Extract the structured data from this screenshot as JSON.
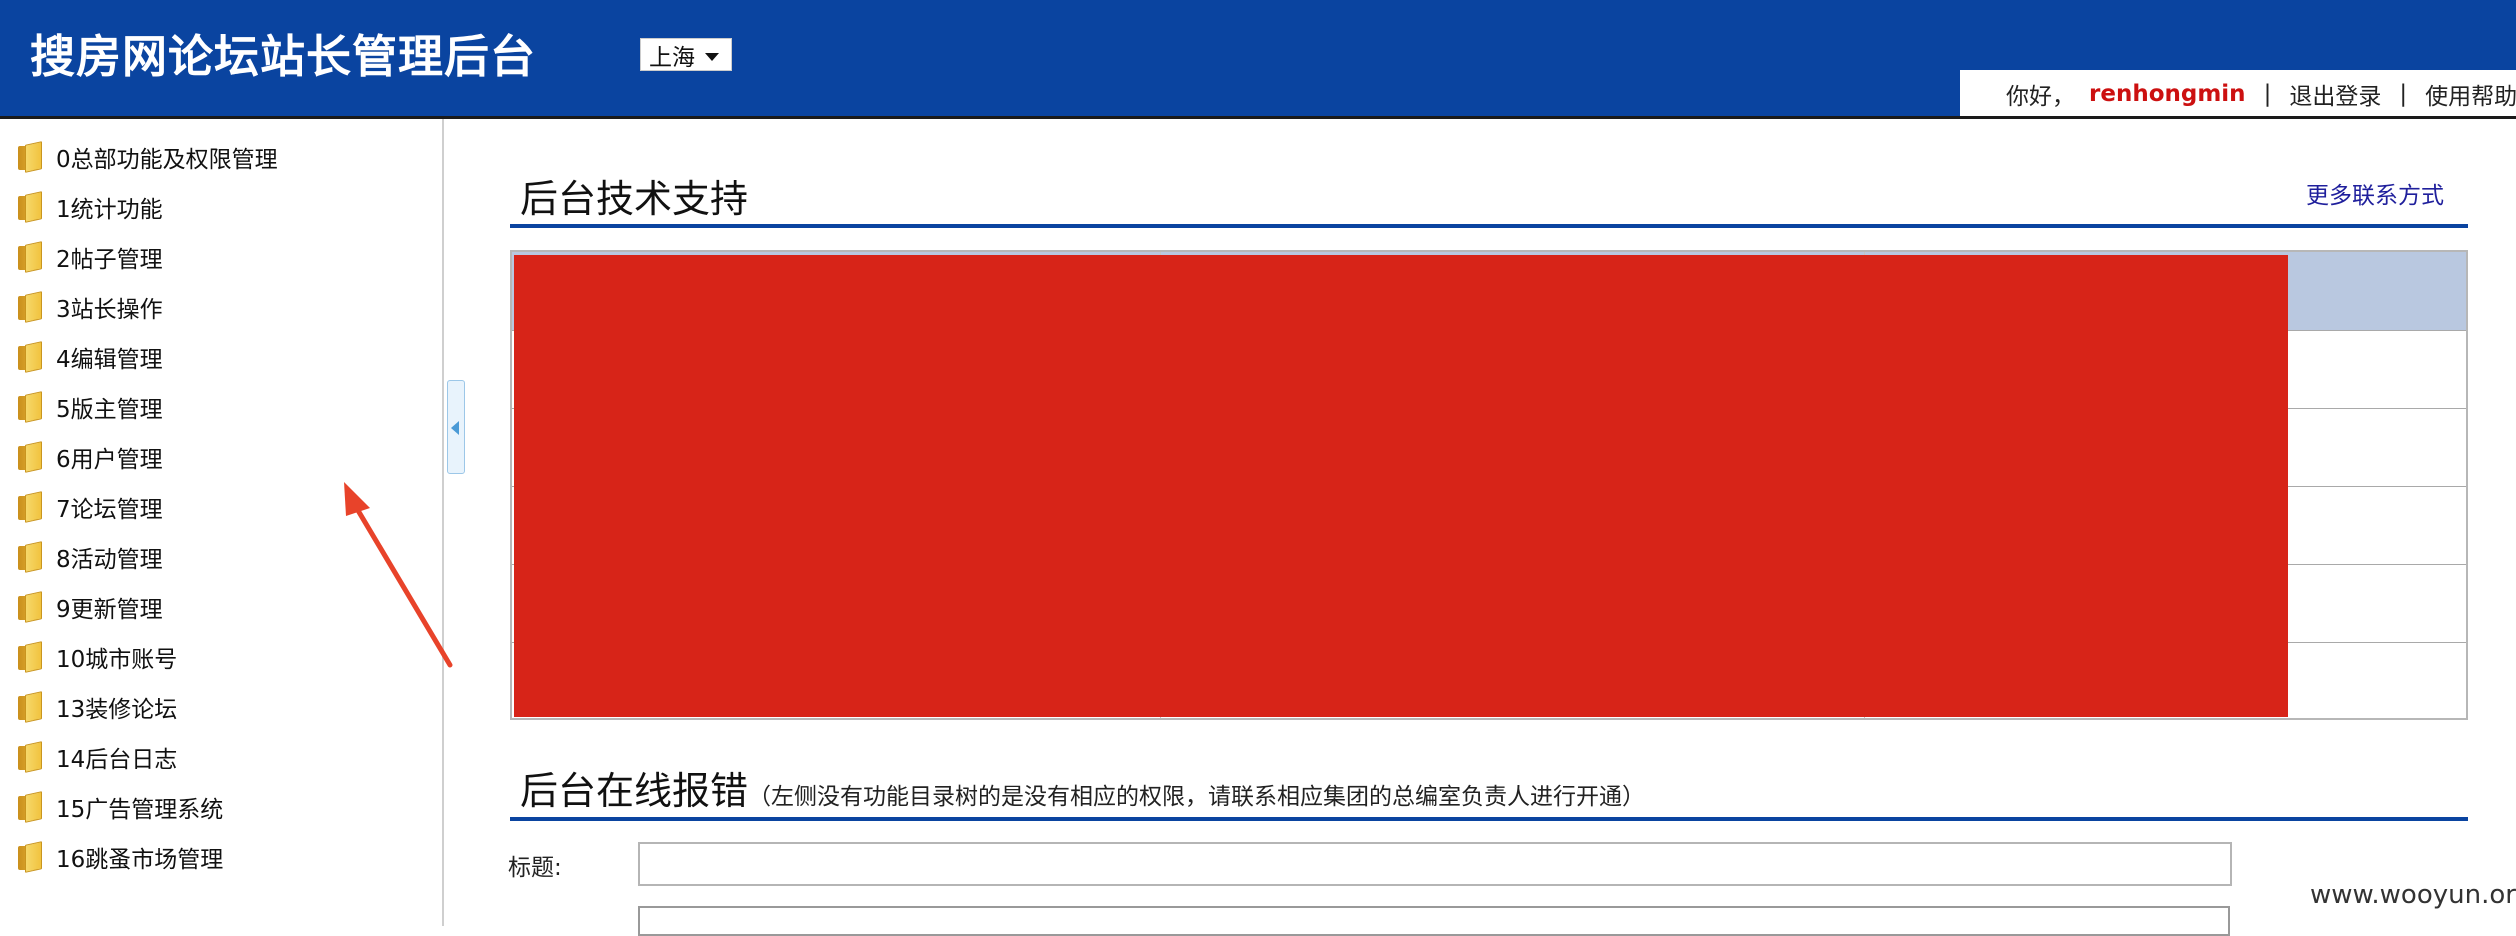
{
  "app": {
    "title": "搜房网论坛站长管理后台"
  },
  "city_select": {
    "value": "上海"
  },
  "user_bar": {
    "greeting": "你好，",
    "username": "renhongmin",
    "separator": "|",
    "logout": "退出登录",
    "help": "使用帮助"
  },
  "sidebar": {
    "items": [
      {
        "label": "0总部功能及权限管理"
      },
      {
        "label": "1统计功能"
      },
      {
        "label": "2帖子管理"
      },
      {
        "label": "3站长操作"
      },
      {
        "label": "4编辑管理"
      },
      {
        "label": "5版主管理"
      },
      {
        "label": "6用户管理"
      },
      {
        "label": "7论坛管理"
      },
      {
        "label": "8活动管理"
      },
      {
        "label": "9更新管理"
      },
      {
        "label": "10城市账号"
      },
      {
        "label": "13装修论坛"
      },
      {
        "label": "14后台日志"
      },
      {
        "label": "15广告管理系统"
      },
      {
        "label": "16跳蚤市场管理"
      }
    ]
  },
  "support": {
    "title": "后台技术支持",
    "more_link": "更多联系方式"
  },
  "report": {
    "title": "后台在线报错",
    "note": "（左侧没有功能目录树的是没有相应的权限，请联系相应集团的总编室负责人进行开通）",
    "title_label": "标题:"
  },
  "watermark": "www.wooyun.org",
  "colors": {
    "header_bg": "#0a44a0",
    "redaction": "#d72418",
    "username": "#cc1010",
    "table_header": "#b9c8e0"
  }
}
